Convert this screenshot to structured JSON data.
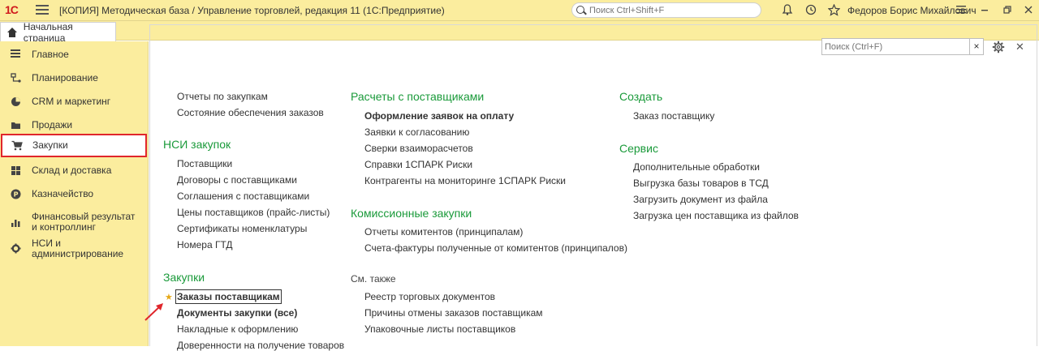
{
  "titlebar": {
    "logo": "1С",
    "title": "[КОПИЯ] Методическая база / Управление торговлей, редакция 11  (1С:Предприятие)",
    "search_placeholder": "Поиск Ctrl+Shift+F",
    "user": "Федоров Борис Михайлович"
  },
  "tabs": {
    "home": "Начальная страница"
  },
  "sidebar": {
    "items": [
      {
        "label": "Главное",
        "icon": "menu-icon"
      },
      {
        "label": "Планирование",
        "icon": "planning-icon"
      },
      {
        "label": "CRM и маркетинг",
        "icon": "pie-chart-icon"
      },
      {
        "label": "Продажи",
        "icon": "folder-icon"
      },
      {
        "label": "Закупки",
        "icon": "cart-icon",
        "active": true
      },
      {
        "label": "Склад и доставка",
        "icon": "warehouse-icon"
      },
      {
        "label": "Казначейство",
        "icon": "money-icon"
      },
      {
        "label": "Финансовый результат и контроллинг",
        "icon": "bar-chart-icon"
      },
      {
        "label": "НСИ и администрирование",
        "icon": "gear-icon"
      }
    ]
  },
  "main": {
    "search_placeholder": "Поиск (Ctrl+F)",
    "col1": {
      "top_links": [
        "Отчеты по закупкам",
        "Состояние обеспечения заказов"
      ],
      "nsi_title": "НСИ закупок",
      "nsi_links": [
        "Поставщики",
        "Договоры с поставщиками",
        "Соглашения с поставщиками",
        "Цены поставщиков (прайс-листы)",
        "Сертификаты номенклатуры",
        "Номера ГТД"
      ],
      "purchases_title": "Закупки",
      "purchases_links": [
        "Заказы поставщикам",
        "Документы закупки (все)",
        "Накладные к оформлению",
        "Доверенности на получение товаров"
      ]
    },
    "col2": {
      "settlements_title": "Расчеты с поставщиками",
      "settlements_links": [
        "Оформление заявок на оплату",
        "Заявки к согласованию",
        "Сверки взаиморасчетов",
        "Справки 1СПАРК Риски",
        "Контрагенты на мониторинге 1СПАРК Риски"
      ],
      "commission_title": "Комиссионные закупки",
      "commission_links": [
        "Отчеты комитентов (принципалам)",
        "Счета-фактуры полученные от комитентов (принципалов)"
      ],
      "see_also": "См. также",
      "see_also_links": [
        "Реестр торговых документов",
        "Причины отмены заказов поставщикам",
        "Упаковочные листы поставщиков"
      ]
    },
    "col3": {
      "create_title": "Создать",
      "create_links": [
        "Заказ поставщику"
      ],
      "service_title": "Сервис",
      "service_links": [
        "Дополнительные обработки",
        "Выгрузка базы товаров в ТСД",
        "Загрузить документ из файла",
        "Загрузка цен поставщика из файлов"
      ]
    }
  },
  "colors": {
    "accent_green": "#1a9a3a",
    "panel_yellow": "#fbed9e",
    "highlight_red": "#e0262b"
  }
}
